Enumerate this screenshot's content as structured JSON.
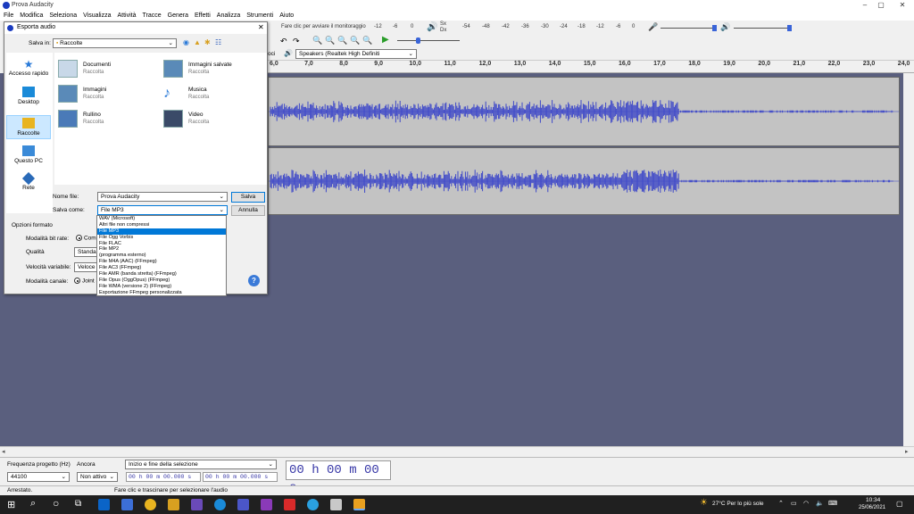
{
  "app": {
    "title": "Prova Audacity",
    "min": "–",
    "max": "▢",
    "close": "✕"
  },
  "menu": [
    "File",
    "Modifica",
    "Seleziona",
    "Visualizza",
    "Attività",
    "Tracce",
    "Genera",
    "Effetti",
    "Analizza",
    "Strumenti",
    "Aiuto"
  ],
  "meters": {
    "record_hint": "Fare clic per avviare il monitoraggio",
    "rec_ticks": [
      "-12",
      "-6",
      "0"
    ],
    "play_ticks": [
      "-54",
      "-48",
      "-42",
      "-36",
      "-30",
      "-24",
      "-18",
      "-12",
      "-6",
      "0"
    ],
    "sx": "Sx",
    "dx": "Dx"
  },
  "devices": {
    "output": "Speakers (Realtek High Definiti",
    "partial": "oci"
  },
  "ruler": [
    "6,0",
    "7,0",
    "8,0",
    "9,0",
    "10,0",
    "11,0",
    "12,0",
    "13,0",
    "14,0",
    "15,0",
    "16,0",
    "17,0",
    "18,0",
    "19,0",
    "20,0",
    "21,0",
    "22,0",
    "23,0",
    "24,0"
  ],
  "dialog": {
    "title": "Esporta audio",
    "close": "✕",
    "save_in_label": "Salva in:",
    "save_in_value": "Raccolte",
    "places": [
      "Accesso rapido",
      "Desktop",
      "Raccolte",
      "Questo PC",
      "Rete"
    ],
    "folders": [
      {
        "name": "Documenti",
        "sub": "Raccolta"
      },
      {
        "name": "Immagini salvate",
        "sub": "Raccolta"
      },
      {
        "name": "Immagini",
        "sub": "Raccolta"
      },
      {
        "name": "Musica",
        "sub": "Raccolta"
      },
      {
        "name": "Rullino",
        "sub": "Raccolta"
      },
      {
        "name": "Video",
        "sub": "Raccolta"
      }
    ],
    "filename_label": "Nome file:",
    "filename_value": "Prova Audacity",
    "saveas_label": "Salva come:",
    "saveas_value": "File MP3",
    "save_button": "Salva",
    "cancel_button": "Annulla",
    "format_options_label": "Opzioni formato",
    "bitrate_label": "Modalità bit rate:",
    "bitrate_value": "Com",
    "quality_label": "Qualità",
    "quality_value": "Standard",
    "vbr_label": "Velocità variabile:",
    "vbr_value": "Veloce",
    "channel_label": "Modalità canale:",
    "channel_value": "Joint S",
    "help": "?"
  },
  "formats": [
    "WAV (Microsoft)",
    "Altri file non compressi",
    "File MP3",
    "File Ogg Vorbis",
    "File FLAC",
    "File MP2",
    "(programma esterno)",
    "File M4A (AAC) (FFmpeg)",
    "File AC3 (FFmpeg)",
    "File AMR (banda stretta) (FFmpeg)",
    "File Opus (OggOpus) (FFmpeg)",
    "File WMA (versione 2) (FFmpeg)",
    "Esportazione FFmpeg personalizzata"
  ],
  "selected_format_index": 2,
  "selection": {
    "rate_label": "Frequenza progetto (Hz)",
    "rate_value": "44100",
    "snap_label": "Ancora",
    "snap_value": "Non attivo",
    "range_label": "Inizio e fine della selezione",
    "start": "00 h 00 m 00.000 s",
    "end": "00 h 00 m 00.000 s",
    "time_display": "00 h 00 m 00 s"
  },
  "status": {
    "left": "Arrestato.",
    "right": "Fare clic e trascinare per selezionare l'audio"
  },
  "taskbar": {
    "weather": "27°C  Per lo più sole",
    "time": "10:34",
    "date": "25/06/2021"
  },
  "colors": {
    "waveform": "#3e48c8",
    "workarea": "#5a5f7e",
    "track": "#c3c3c3",
    "selection": "#0078d7"
  }
}
